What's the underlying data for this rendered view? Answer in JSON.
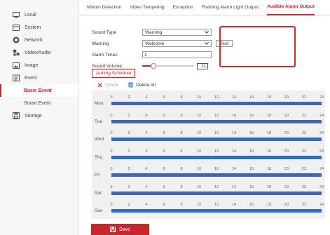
{
  "sidebar": {
    "items": [
      {
        "label": "Local",
        "icon": "monitor-icon"
      },
      {
        "label": "System",
        "icon": "system-icon"
      },
      {
        "label": "Network",
        "icon": "network-icon"
      },
      {
        "label": "Video/Audio",
        "icon": "video-audio-icon"
      },
      {
        "label": "Image",
        "icon": "image-icon"
      },
      {
        "label": "Event",
        "icon": "event-icon"
      },
      {
        "label": "Basic Event"
      },
      {
        "label": "Smart Event"
      },
      {
        "label": "Storage",
        "icon": "storage-icon"
      }
    ]
  },
  "tabs": [
    {
      "label": "Motion Detection"
    },
    {
      "label": "Video Tampering"
    },
    {
      "label": "Exception"
    },
    {
      "label": "Flashing Alarm Light Output"
    },
    {
      "label": "Audible Alarm Output"
    }
  ],
  "form": {
    "sound_type_label": "Sound Type",
    "sound_type_value": "Warning",
    "warning_label": "Warning",
    "warning_value": "Welcome",
    "test_label": "Test",
    "alarm_times_label": "Alarm Times",
    "alarm_times_value": "1",
    "sound_volume_label": "Sound Volume",
    "sound_volume_value": "11"
  },
  "arming_schedule_label": "Arming Schedule",
  "actions": {
    "delete_label": "Delete",
    "delete_all_label": "Delete All"
  },
  "schedule": {
    "days": [
      "Mon",
      "Tue",
      "Wed",
      "Thu",
      "Fri",
      "Sat",
      "Sun"
    ],
    "ticks": [
      "0",
      "2",
      "4",
      "6",
      "8",
      "10",
      "12",
      "14",
      "16",
      "18",
      "20",
      "22",
      "24"
    ]
  },
  "save_label": "Save",
  "colors": {
    "accent": "#c9252d",
    "schedule_bar": "#3d68b8"
  }
}
